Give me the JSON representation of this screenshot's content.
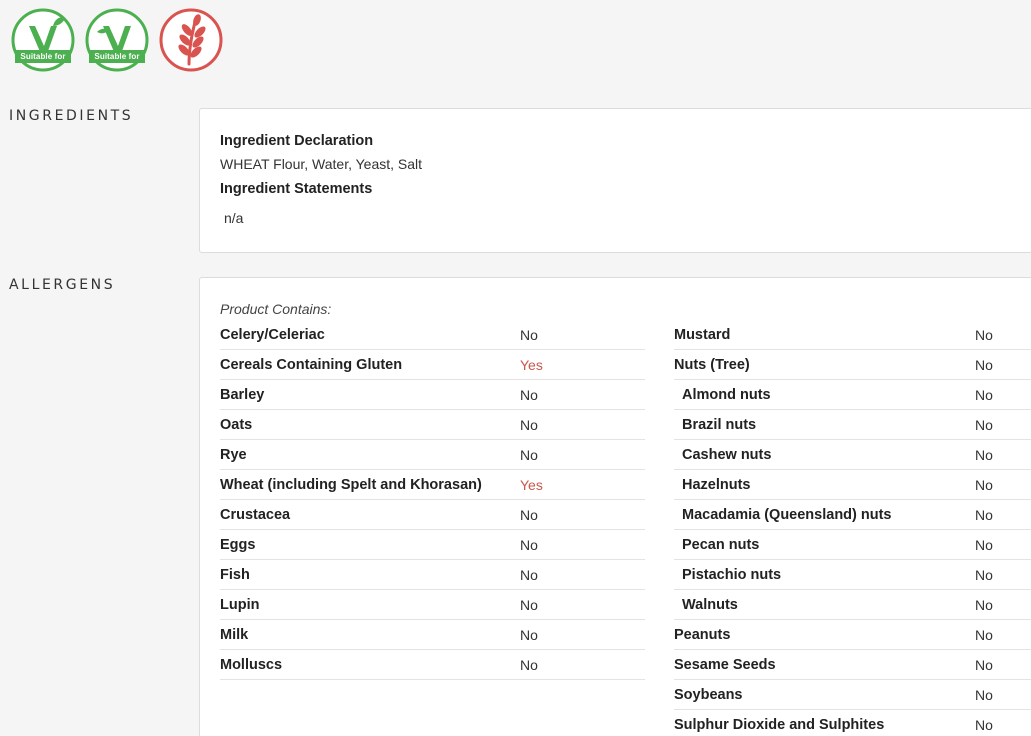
{
  "badges": [
    {
      "icon": "vegetarian-icon",
      "caption": "Suitable for",
      "color": "#4caf50"
    },
    {
      "icon": "vegan-icon",
      "caption": "Suitable for",
      "color": "#4caf50"
    },
    {
      "icon": "gluten-wheat-icon",
      "caption": "",
      "color": "#d9534f"
    }
  ],
  "ingredients": {
    "section_label": "INGREDIENTS",
    "declaration_title": "Ingredient Declaration",
    "declaration_text": "WHEAT Flour, Water, Yeast, Salt",
    "statements_title": "Ingredient Statements",
    "statements_text": "n/a"
  },
  "allergens": {
    "section_label": "ALLERGENS",
    "contains_label": "Product Contains:",
    "yes_color": "#c9574b",
    "left": [
      {
        "name": "Celery/Celeriac",
        "value": "No"
      },
      {
        "name": "Cereals Containing Gluten",
        "value": "Yes"
      },
      {
        "name": "Barley",
        "value": "No"
      },
      {
        "name": "Oats",
        "value": "No"
      },
      {
        "name": "Rye",
        "value": "No"
      },
      {
        "name": "Wheat (including Spelt and Khorasan)",
        "value": "Yes"
      },
      {
        "name": "Crustacea",
        "value": "No"
      },
      {
        "name": "Eggs",
        "value": "No"
      },
      {
        "name": "Fish",
        "value": "No"
      },
      {
        "name": "Lupin",
        "value": "No"
      },
      {
        "name": "Milk",
        "value": "No"
      },
      {
        "name": "Molluscs",
        "value": "No"
      }
    ],
    "right": [
      {
        "name": "Mustard",
        "value": "No"
      },
      {
        "name": "Nuts (Tree)",
        "value": "No"
      },
      {
        "name": "Almond nuts",
        "value": "No"
      },
      {
        "name": "Brazil nuts",
        "value": "No"
      },
      {
        "name": "Cashew nuts",
        "value": "No"
      },
      {
        "name": "Hazelnuts",
        "value": "No"
      },
      {
        "name": "Macadamia (Queensland) nuts",
        "value": "No"
      },
      {
        "name": "Pecan nuts",
        "value": "No"
      },
      {
        "name": "Pistachio nuts",
        "value": "No"
      },
      {
        "name": "Walnuts",
        "value": "No"
      },
      {
        "name": "Peanuts",
        "value": "No"
      },
      {
        "name": "Sesame Seeds",
        "value": "No"
      },
      {
        "name": "Soybeans",
        "value": "No"
      },
      {
        "name": "Sulphur Dioxide and Sulphites",
        "value": "No"
      }
    ]
  }
}
